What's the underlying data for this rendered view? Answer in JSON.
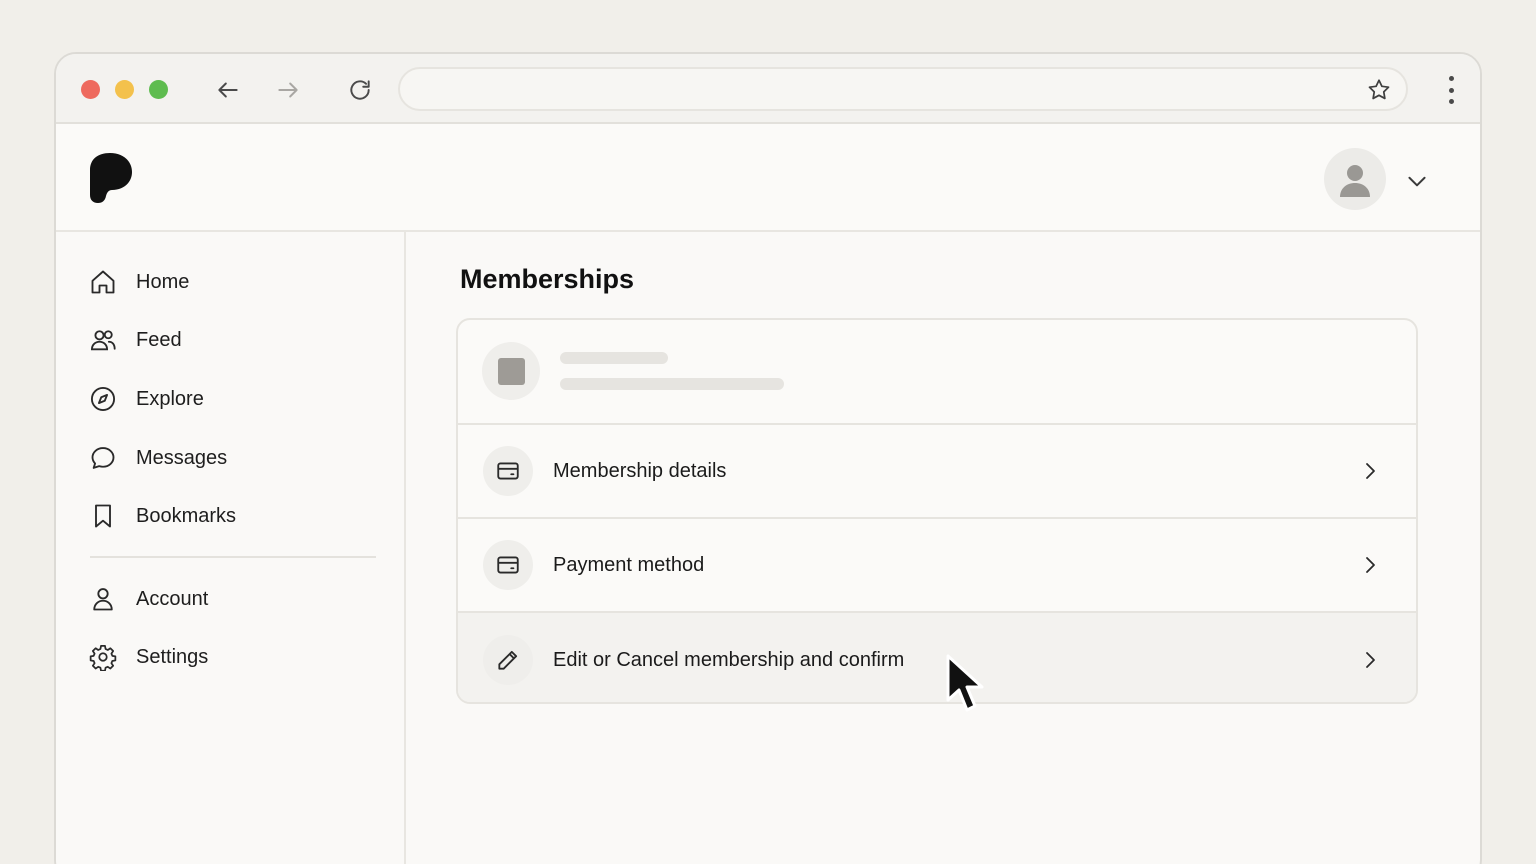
{
  "browser": {
    "window_controls": [
      "close",
      "minimize",
      "maximize"
    ],
    "back_icon": "arrow-left-icon",
    "forward_icon": "arrow-right-icon",
    "reload_icon": "reload-icon",
    "url": "",
    "bookmark_icon": "star-icon",
    "menu_icon": "kebab-menu-icon"
  },
  "header": {
    "logo_icon": "brand-p-logo",
    "avatar_icon": "user-avatar-icon",
    "account_menu_icon": "chevron-down-icon"
  },
  "sidebar": {
    "items": [
      {
        "label": "Home",
        "icon": "home-icon"
      },
      {
        "label": "Feed",
        "icon": "people-icon"
      },
      {
        "label": "Explore",
        "icon": "compass-icon"
      },
      {
        "label": "Messages",
        "icon": "chat-bubble-icon"
      },
      {
        "label": "Bookmarks",
        "icon": "bookmark-icon"
      }
    ],
    "secondary_items": [
      {
        "label": "Account",
        "icon": "user-icon"
      },
      {
        "label": "Settings",
        "icon": "gear-icon"
      }
    ]
  },
  "main": {
    "title": "Memberships",
    "card": {
      "rows": [
        {
          "label": "Membership details",
          "icon": "card-icon"
        },
        {
          "label": "Payment method",
          "icon": "card-icon"
        },
        {
          "label": "Edit or Cancel membership and confirm",
          "icon": "pencil-icon"
        }
      ]
    }
  },
  "colors": {
    "background": "#f1efea",
    "window": "#faf9f7",
    "close": "#ee6a5e",
    "minimize": "#f3c14c",
    "maximize": "#5ebc4f",
    "text": "#1c1c1c"
  }
}
